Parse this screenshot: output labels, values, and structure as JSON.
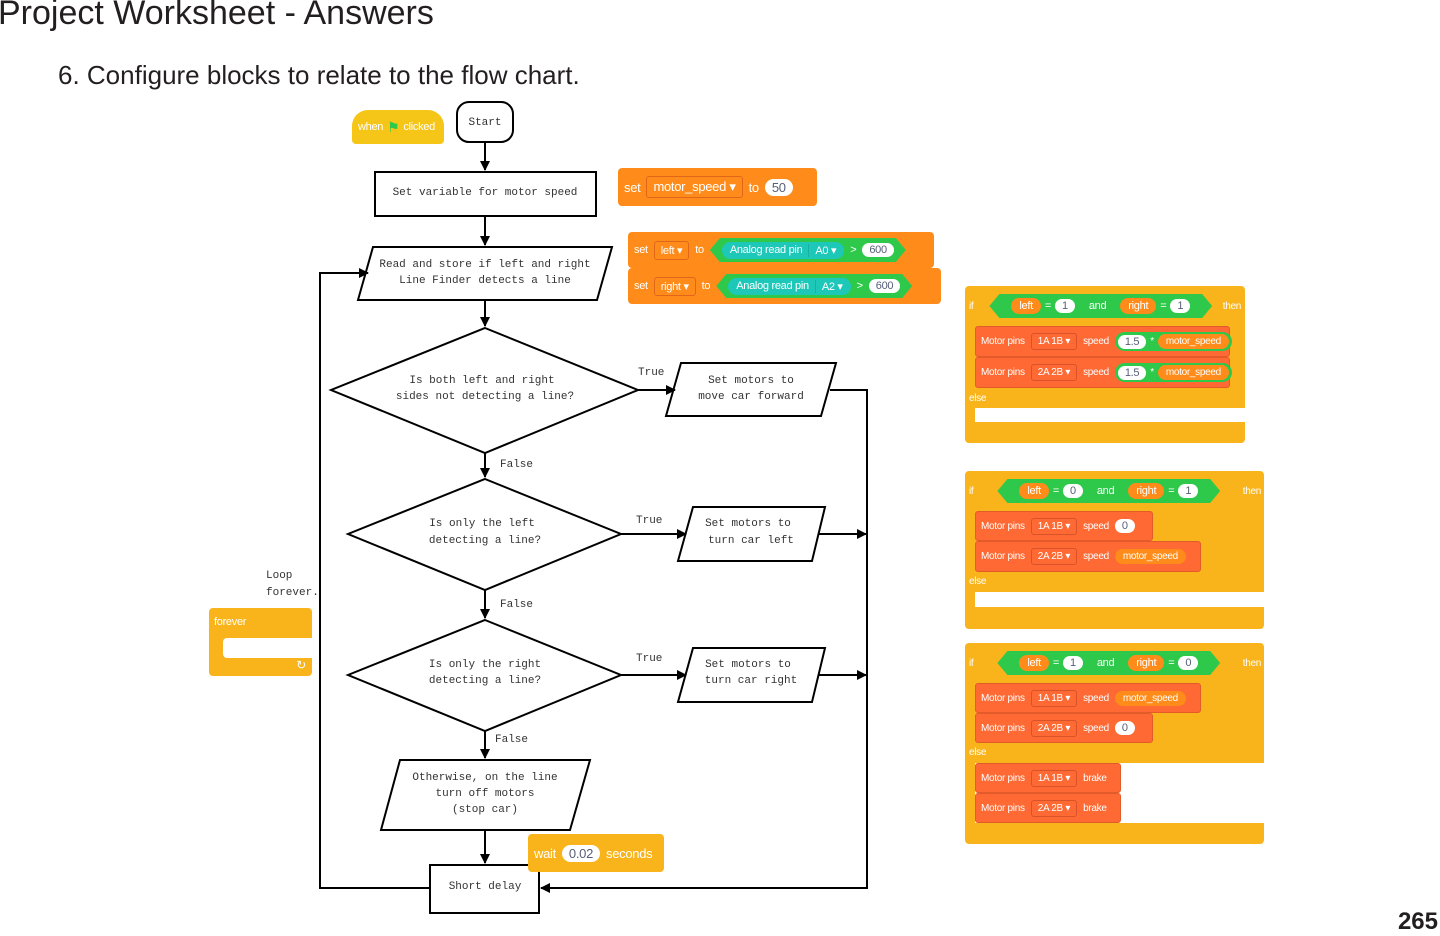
{
  "page": {
    "title": "Project Worksheet - Answers",
    "question": "6. Configure blocks to relate to the flow chart.",
    "page_number": "265"
  },
  "flowchart": {
    "start": "Start",
    "set_variable": "Set variable for motor speed",
    "read_line1": "Read and store if left and right",
    "read_line2": "Line Finder detects a line",
    "decision1_line1": "Is both left and right",
    "decision1_line2": "sides not detecting a line?",
    "action1_line1": "Set motors to",
    "action1_line2": "move car forward",
    "decision2_line1": "Is only the left",
    "decision2_line2": "detecting a line?",
    "action2_line1": "Set motors to",
    "action2_line2": "turn car left",
    "decision3_line1": "Is only the right",
    "decision3_line2": "detecting a line?",
    "action3_line1": "Set motors to",
    "action3_line2": "turn car right",
    "otherwise_line1": "Otherwise, on the line",
    "otherwise_line2": "turn off motors",
    "otherwise_line3": "(stop car)",
    "short_delay": "Short delay",
    "true_label": "True",
    "false_label": "False",
    "loop_line1": "Loop",
    "loop_line2": "forever."
  },
  "blocks": {
    "when_flag": {
      "when": "when",
      "clicked": "clicked",
      "icon": "green-flag-icon"
    },
    "set_speed": {
      "set": "set",
      "variable": "motor_speed",
      "to": "to",
      "value": "50"
    },
    "set_left": {
      "set": "set",
      "variable": "left",
      "to": "to",
      "sensor": "Analog read pin",
      "pin": "A0",
      "op": ">",
      "value": "600"
    },
    "set_right": {
      "set": "set",
      "variable": "right",
      "to": "to",
      "sensor": "Analog read pin",
      "pin": "A2",
      "op": ">",
      "value": "600"
    },
    "forever": {
      "label": "forever",
      "icon": "loop-arrow-icon"
    },
    "wait": {
      "wait": "wait",
      "value": "0.02",
      "seconds": "seconds"
    },
    "if_common": {
      "if": "if",
      "and": "and",
      "then": "then",
      "else": "else",
      "eq": "=",
      "left": "left",
      "right": "right",
      "motor_pins": "Motor pins",
      "speed": "speed",
      "brake": "brake",
      "pins_1": "1A 1B",
      "pins_2": "2A 2B",
      "motor_speed": "motor_speed",
      "times": "*"
    },
    "if1": {
      "left_val": "1",
      "right_val": "1",
      "mult1": "1.5",
      "mult2": "1.5"
    },
    "if2": {
      "left_val": "0",
      "right_val": "1",
      "speed1": "0"
    },
    "if3": {
      "left_val": "1",
      "right_val": "0",
      "speed2": "0"
    }
  },
  "colors": {
    "events": "#f5c518",
    "variables": "#ff8c1a",
    "control": "#f8b41a",
    "motors": "#fe6934",
    "operators": "#2ec84a",
    "sensors": "#1ec8b8"
  }
}
